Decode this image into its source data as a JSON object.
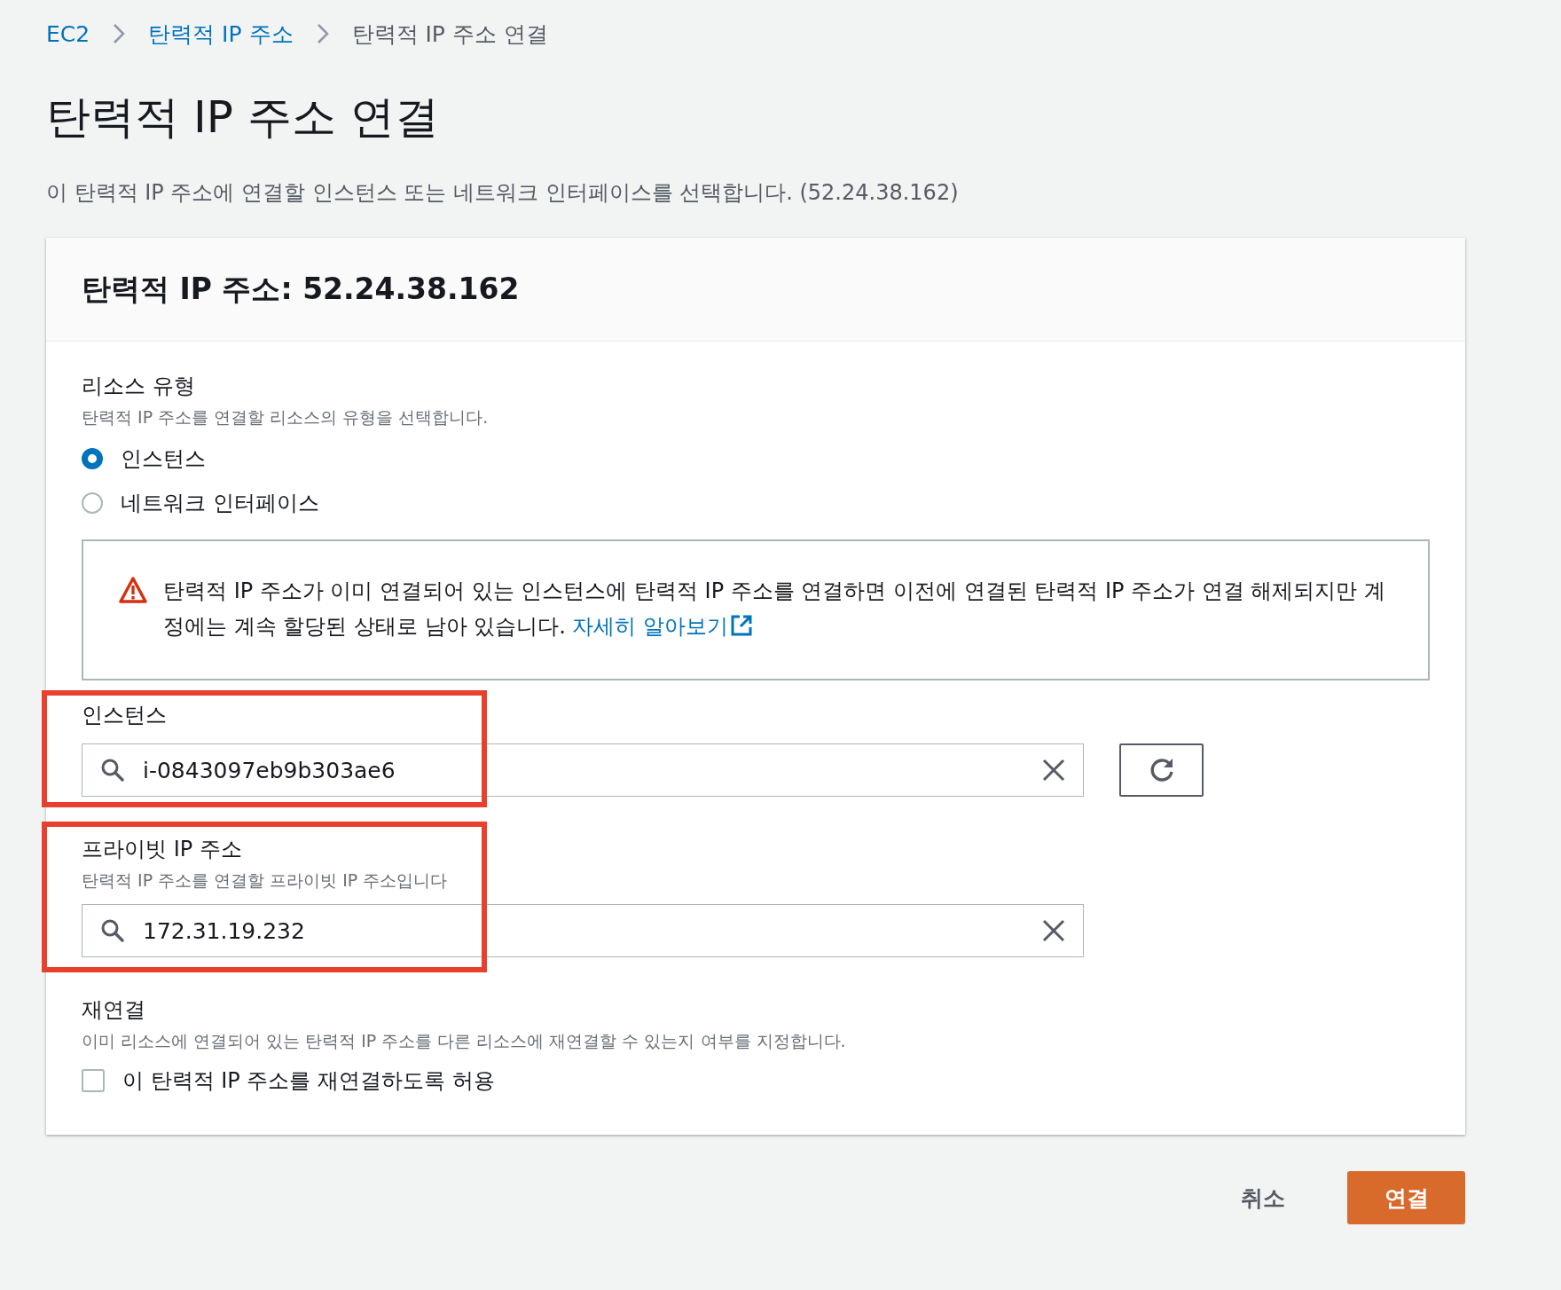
{
  "breadcrumbs": [
    {
      "label": "EC2",
      "link": true
    },
    {
      "label": "탄력적 IP 주소",
      "link": true
    },
    {
      "label": "탄력적 IP 주소 연결",
      "link": false
    }
  ],
  "title": "탄력적 IP 주소 연결",
  "description": "이 탄력적 IP 주소에 연결할 인스턴스 또는 네트워크 인터페이스를 선택합니다. (52.24.38.162)",
  "card": {
    "header": "탄력적 IP 주소: 52.24.38.162",
    "resource_type": {
      "label": "리소스 유형",
      "hint": "탄력적 IP 주소를 연결할 리소스의 유형을 선택합니다.",
      "options": [
        {
          "label": "인스턴스",
          "selected": true
        },
        {
          "label": "네트워크 인터페이스",
          "selected": false
        }
      ]
    },
    "alert": {
      "text": "탄력적 IP 주소가 이미 연결되어 있는 인스턴스에 탄력적 IP 주소를 연결하면 이전에 연결된 탄력적 IP 주소가 연결 해제되지만 계정에는 계속 할당된 상태로 남아 있습니다.",
      "link": "자세히 알아보기"
    },
    "instance": {
      "label": "인스턴스",
      "value": "i-0843097eb9b303ae6"
    },
    "private_ip": {
      "label": "프라이빗 IP 주소",
      "hint": "탄력적 IP 주소를 연결할 프라이빗 IP 주소입니다",
      "value": "172.31.19.232"
    },
    "reassociation": {
      "label": "재연결",
      "hint": "이미 리소스에 연결되어 있는 탄력적 IP 주소를 다른 리소스에 재연결할 수 있는지 여부를 지정합니다.",
      "checkbox": {
        "label": "이 탄력적 IP 주소를 재연결하도록 허용",
        "checked": false
      }
    }
  },
  "buttons": [
    {
      "label": "취소",
      "kind": "secondary"
    },
    {
      "label": "연결",
      "kind": "primary"
    }
  ]
}
